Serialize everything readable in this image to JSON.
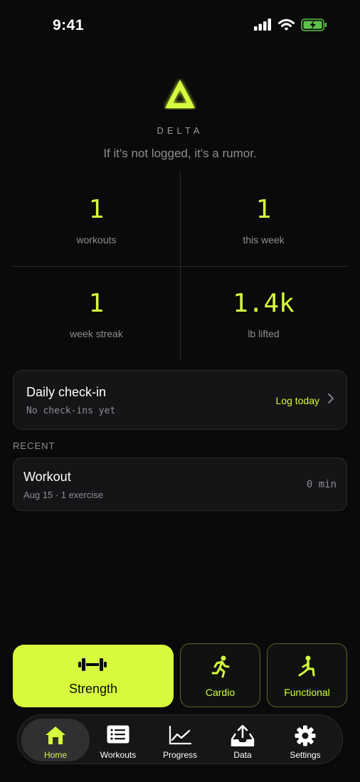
{
  "status_bar": {
    "time": "9:41",
    "icons": [
      "cellular-signal-icon",
      "wifi-icon",
      "battery-charging-icon"
    ],
    "battery_color": "#5ec24a"
  },
  "header": {
    "logo_glyph": "Δ",
    "brand": "DELTA",
    "tagline": "If it's not logged, it's a rumor."
  },
  "stats": [
    {
      "value": "1",
      "label": "workouts"
    },
    {
      "value": "1",
      "label": "this week"
    },
    {
      "value": "1",
      "label": "week streak"
    },
    {
      "value": "1.4k",
      "label": "lb lifted"
    }
  ],
  "checkin": {
    "title": "Daily check-in",
    "subtitle": "No check-ins yet",
    "action_label": "Log today",
    "action_icon": "chevron-right-icon"
  },
  "recent": {
    "section_label": "RECENT",
    "items": [
      {
        "title": "Workout",
        "meta": "Aug 15 · 1 exercise",
        "duration": "0 min"
      }
    ]
  },
  "quick_start": [
    {
      "label": "Strength",
      "icon": "dumbbell-icon"
    },
    {
      "label": "Cardio",
      "icon": "running-icon"
    },
    {
      "label": "Functional",
      "icon": "lunge-icon"
    }
  ],
  "tabs": [
    {
      "label": "Home",
      "icon": "home-icon",
      "active": true
    },
    {
      "label": "Workouts",
      "icon": "list-icon",
      "active": false
    },
    {
      "label": "Progress",
      "icon": "chart-line-icon",
      "active": false
    },
    {
      "label": "Data",
      "icon": "tray-upload-icon",
      "active": false
    },
    {
      "label": "Settings",
      "icon": "gear-icon",
      "active": false
    }
  ],
  "colors": {
    "accent": "#d7fb3c",
    "background": "#0a0a0b",
    "card": "#151517",
    "muted_text": "#8e8e93"
  }
}
